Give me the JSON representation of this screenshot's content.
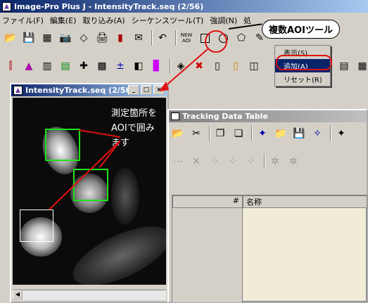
{
  "app": {
    "title": "Image-Pro Plus J - IntensityTrack.seq (2/56)"
  },
  "menubar": {
    "items": [
      "ファイル(F)",
      "編集(E)",
      "取り込み(A)",
      "シーケンスツール(T)",
      "強調(N)",
      "処"
    ]
  },
  "toolbar1": {
    "new_aoi_label": "NEW\nAOI"
  },
  "callout": {
    "text": "複数AOIツール"
  },
  "aoi_menu": {
    "items": [
      "表示(S)",
      "追加(A)",
      "リセット(R)"
    ],
    "selected_index": 1
  },
  "image_window": {
    "title": "IntensityTrack.seq (2/56)"
  },
  "annotation": {
    "line1": "測定箇所を",
    "line2": "AOIで囲み",
    "line3": "ます"
  },
  "tracking_window": {
    "title": "Tracking Data Table",
    "columns": [
      "#",
      "名称"
    ]
  },
  "colors": {
    "title_blue": "#0a246a",
    "aoi_green": "#1ee31e",
    "arrow_red": "#e01010"
  }
}
